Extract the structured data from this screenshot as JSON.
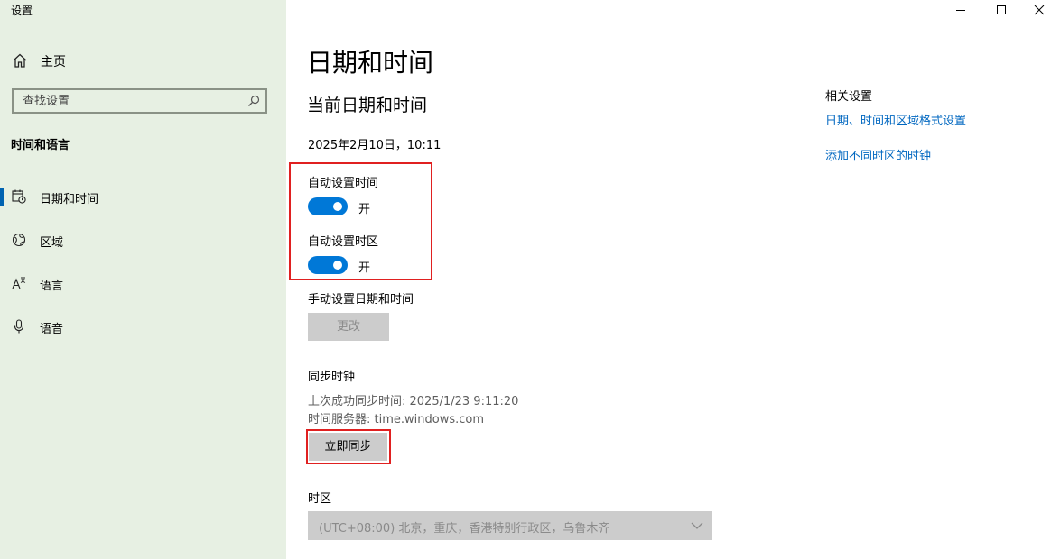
{
  "window": {
    "title": "设置"
  },
  "sidebar": {
    "home_label": "主页",
    "search_placeholder": "查找设置",
    "section_title": "时间和语言",
    "items": [
      {
        "label": "日期和时间",
        "icon": "calendar-clock-icon",
        "active": true
      },
      {
        "label": "区域",
        "icon": "globe-icon",
        "active": false
      },
      {
        "label": "语言",
        "icon": "language-icon",
        "active": false
      },
      {
        "label": "语音",
        "icon": "microphone-icon",
        "active": false
      }
    ]
  },
  "main": {
    "title": "日期和时间",
    "subtitle": "当前日期和时间",
    "current_datetime": "2025年2月10日，10:11",
    "auto_time": {
      "label": "自动设置时间",
      "state": "开"
    },
    "auto_timezone": {
      "label": "自动设置时区",
      "state": "开"
    },
    "manual": {
      "label": "手动设置日期和时间",
      "button": "更改"
    },
    "sync": {
      "label": "同步时钟",
      "last_sync": "上次成功同步时间: 2025/1/23 9:11:20",
      "server": "时间服务器: time.windows.com",
      "button": "立即同步"
    },
    "timezone": {
      "label": "时区",
      "value": "(UTC+08:00) 北京，重庆，香港特别行政区，乌鲁木齐"
    }
  },
  "related": {
    "title": "相关设置",
    "links": [
      "日期、时间和区域格式设置",
      "添加不同时区的时钟"
    ]
  },
  "colors": {
    "sidebar_bg": "#e7f0e3",
    "accent": "#0078d7",
    "link": "#0067c0",
    "highlight": "#e02020"
  }
}
